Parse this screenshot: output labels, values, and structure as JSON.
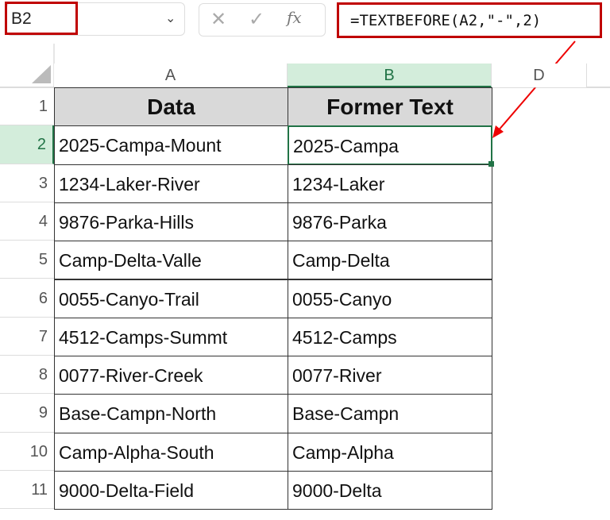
{
  "name_box": "B2",
  "formula": "=TEXTBEFORE(A2,\"-\",2)",
  "columns": [
    "A",
    "B",
    "D"
  ],
  "headers": [
    "Data",
    "Former Text"
  ],
  "rows": [
    {
      "n": "1"
    },
    {
      "n": "2",
      "a": "2025-Campa-Mount",
      "b": "2025-Campa"
    },
    {
      "n": "3",
      "a": "1234-Laker-River",
      "b": "1234-Laker"
    },
    {
      "n": "4",
      "a": "9876-Parka-Hills",
      "b": "9876-Parka"
    },
    {
      "n": "5",
      "a": "Camp-Delta-Valle",
      "b": "Camp-Delta"
    },
    {
      "n": "6",
      "a": "0055-Canyo-Trail",
      "b": "0055-Canyo"
    },
    {
      "n": "7",
      "a": "4512-Camps-Summt",
      "b": "4512-Camps"
    },
    {
      "n": "8",
      "a": "0077-River-Creek",
      "b": "0077-River"
    },
    {
      "n": "9",
      "a": "Base-Campn-North",
      "b": "Base-Campn"
    },
    {
      "n": "10",
      "a": "Camp-Alpha-South",
      "b": "Camp-Alpha"
    },
    {
      "n": "11",
      "a": "9000-Delta-Field",
      "b": "9000-Delta"
    }
  ],
  "colors": {
    "accent": "#217346",
    "highlight": "#c00000"
  }
}
